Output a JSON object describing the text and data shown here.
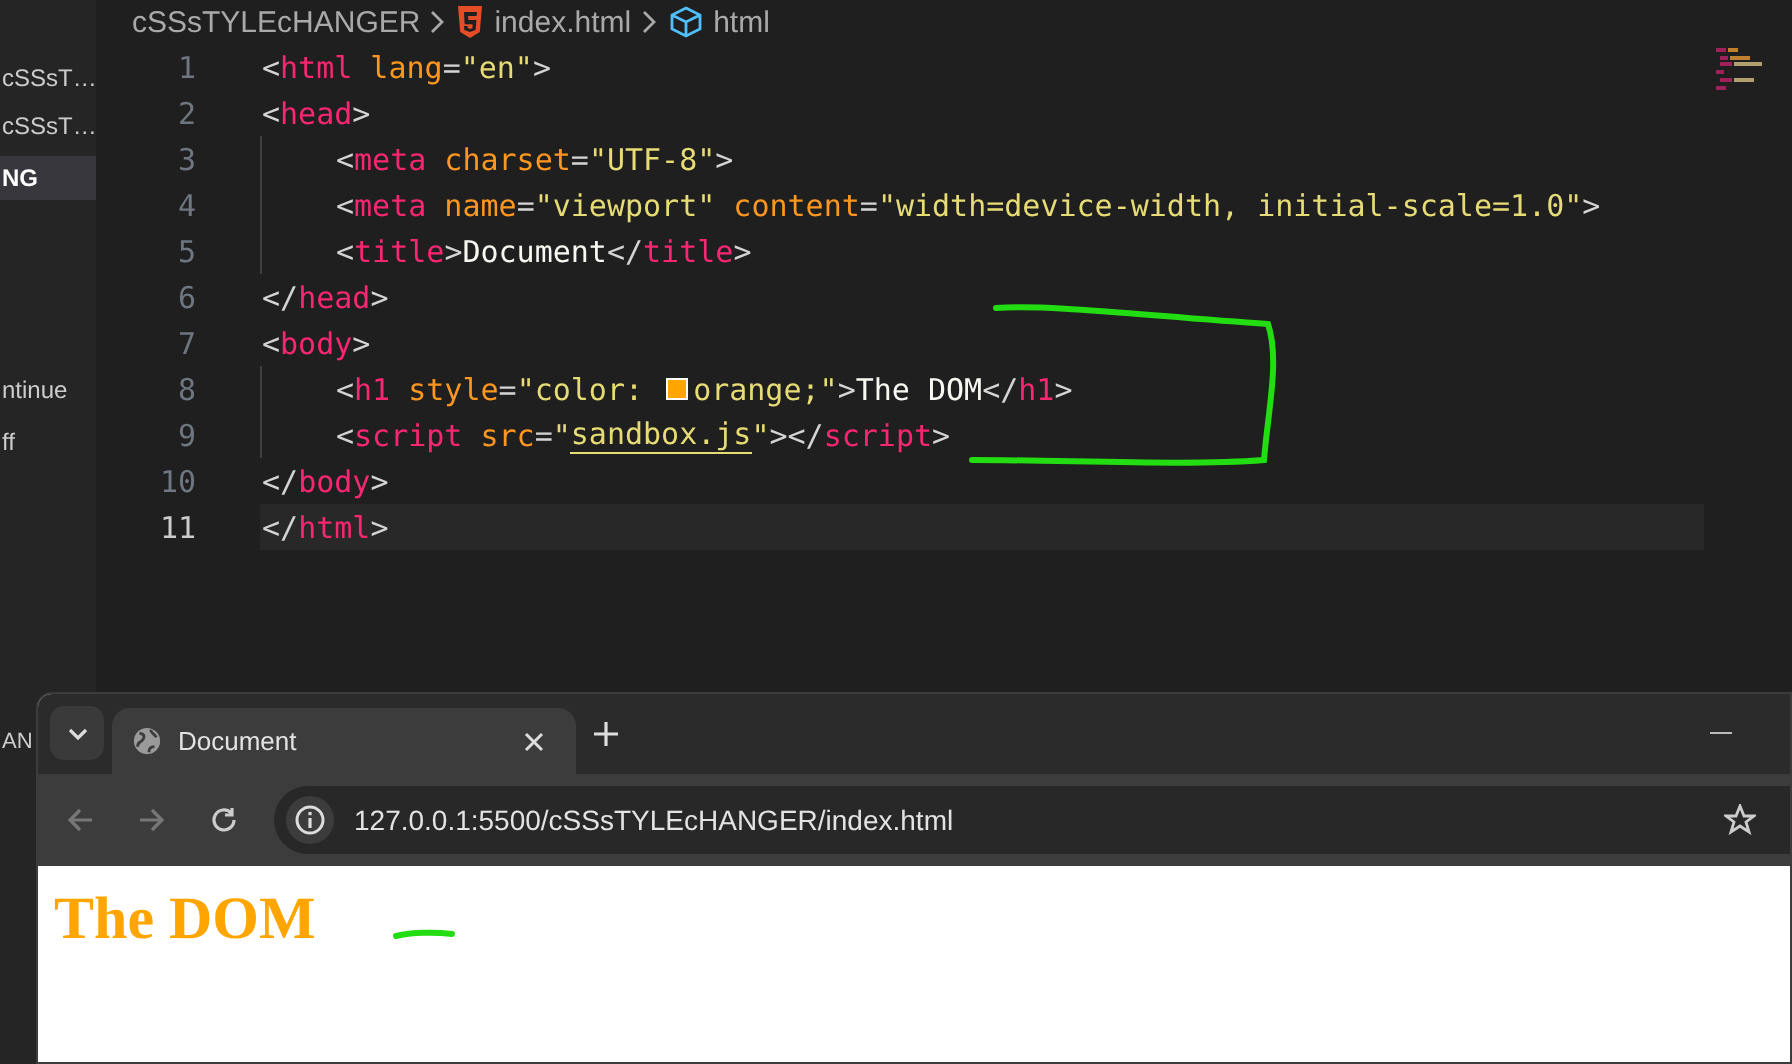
{
  "sidebar": {
    "items": [
      {
        "label": "cSSsT…",
        "selected": false
      },
      {
        "label": "cSSsT…",
        "selected": false
      },
      {
        "label": "NG",
        "selected": true
      },
      {
        "label": "ntinue",
        "selected": false
      },
      {
        "label": "ff",
        "selected": false
      },
      {
        "label": "AN",
        "selected": false
      }
    ]
  },
  "breadcrumb": [
    {
      "kind": "folder",
      "label": "cSSsTYLEcHANGER"
    },
    {
      "kind": "html-file",
      "label": "index.html"
    },
    {
      "kind": "element",
      "label": "html"
    }
  ],
  "editor": {
    "lines": [
      {
        "number": "1",
        "indented": false,
        "current": false,
        "tokens": [
          {
            "kind": "punct",
            "text": "<"
          },
          {
            "kind": "tag",
            "text": "html"
          },
          {
            "kind": "attr",
            "text": " lang"
          },
          {
            "kind": "punct",
            "text": "="
          },
          {
            "kind": "string",
            "text": "\"en\""
          },
          {
            "kind": "punct",
            "text": ">"
          }
        ]
      },
      {
        "number": "2",
        "indented": false,
        "current": false,
        "tokens": [
          {
            "kind": "punct",
            "text": "<"
          },
          {
            "kind": "tag",
            "text": "head"
          },
          {
            "kind": "punct",
            "text": ">"
          }
        ]
      },
      {
        "number": "3",
        "indented": true,
        "current": false,
        "tokens": [
          {
            "kind": "punct",
            "text": "<"
          },
          {
            "kind": "tag",
            "text": "meta"
          },
          {
            "kind": "attr",
            "text": " charset"
          },
          {
            "kind": "punct",
            "text": "="
          },
          {
            "kind": "string",
            "text": "\"UTF-8\""
          },
          {
            "kind": "punct",
            "text": ">"
          }
        ]
      },
      {
        "number": "4",
        "indented": true,
        "current": false,
        "tokens": [
          {
            "kind": "punct",
            "text": "<"
          },
          {
            "kind": "tag",
            "text": "meta"
          },
          {
            "kind": "attr",
            "text": " name"
          },
          {
            "kind": "punct",
            "text": "="
          },
          {
            "kind": "string",
            "text": "\"viewport\""
          },
          {
            "kind": "attr",
            "text": " content"
          },
          {
            "kind": "punct",
            "text": "="
          },
          {
            "kind": "string",
            "text": "\"width=device-width, initial-scale=1.0\""
          },
          {
            "kind": "punct",
            "text": ">"
          }
        ]
      },
      {
        "number": "5",
        "indented": true,
        "current": false,
        "tokens": [
          {
            "kind": "punct",
            "text": "<"
          },
          {
            "kind": "tag",
            "text": "title"
          },
          {
            "kind": "punct",
            "text": ">"
          },
          {
            "kind": "text",
            "text": "Document"
          },
          {
            "kind": "punct",
            "text": "</"
          },
          {
            "kind": "tag",
            "text": "title"
          },
          {
            "kind": "punct",
            "text": ">"
          }
        ]
      },
      {
        "number": "6",
        "indented": false,
        "current": false,
        "tokens": [
          {
            "kind": "punct",
            "text": "</"
          },
          {
            "kind": "tag",
            "text": "head"
          },
          {
            "kind": "punct",
            "text": ">"
          }
        ]
      },
      {
        "number": "7",
        "indented": false,
        "current": false,
        "tokens": [
          {
            "kind": "punct",
            "text": "<"
          },
          {
            "kind": "tag",
            "text": "body"
          },
          {
            "kind": "punct",
            "text": ">"
          }
        ]
      },
      {
        "number": "8",
        "indented": true,
        "current": false,
        "tokens": [
          {
            "kind": "punct",
            "text": "<"
          },
          {
            "kind": "tag",
            "text": "h1"
          },
          {
            "kind": "attr",
            "text": " style"
          },
          {
            "kind": "punct",
            "text": "="
          },
          {
            "kind": "string",
            "text": "\"color: "
          },
          {
            "kind": "swatch",
            "color": "#ffa500"
          },
          {
            "kind": "string",
            "text": "orange;\""
          },
          {
            "kind": "punct",
            "text": ">"
          },
          {
            "kind": "text",
            "text": "The DOM"
          },
          {
            "kind": "punct",
            "text": "</"
          },
          {
            "kind": "tag",
            "text": "h1"
          },
          {
            "kind": "punct",
            "text": ">"
          }
        ]
      },
      {
        "number": "9",
        "indented": true,
        "current": false,
        "tokens": [
          {
            "kind": "punct",
            "text": "<"
          },
          {
            "kind": "tag",
            "text": "script"
          },
          {
            "kind": "attr",
            "text": " src"
          },
          {
            "kind": "punct",
            "text": "="
          },
          {
            "kind": "string",
            "text": "\""
          },
          {
            "kind": "link",
            "text": "sandbox.js"
          },
          {
            "kind": "string",
            "text": "\""
          },
          {
            "kind": "punct",
            "text": "></"
          },
          {
            "kind": "tag",
            "text": "script"
          },
          {
            "kind": "punct",
            "text": ">"
          }
        ]
      },
      {
        "number": "10",
        "indented": false,
        "current": false,
        "tokens": [
          {
            "kind": "punct",
            "text": "</"
          },
          {
            "kind": "tag",
            "text": "body"
          },
          {
            "kind": "punct",
            "text": ">"
          }
        ]
      },
      {
        "number": "11",
        "indented": false,
        "current": true,
        "tokens": [
          {
            "kind": "punct",
            "text": "</"
          },
          {
            "kind": "tag",
            "text": "html"
          },
          {
            "kind": "punct",
            "text": ">"
          }
        ]
      }
    ]
  },
  "browser": {
    "tabs": [
      {
        "title": "Document",
        "selected": true
      }
    ],
    "address": "127.0.0.1:5500/cSSsTYLEcHANGER/index.html",
    "page": {
      "heading": "The DOM"
    }
  }
}
